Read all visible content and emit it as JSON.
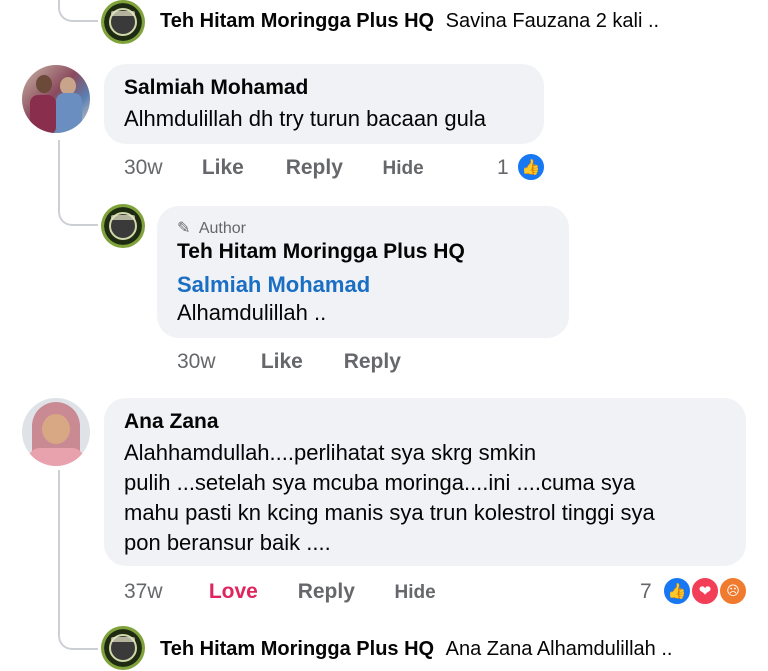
{
  "colors": {
    "thread_line": "#ccd0d5",
    "bubble_bg": "#f0f2f5",
    "meta_gray": "#65676b",
    "mention_blue": "#1a6fc4",
    "love_red": "#e0245e",
    "like_blue": "#1877f2"
  },
  "top_reply": {
    "page_name": "Teh Hitam Moringga Plus HQ",
    "preview": "Savina Fauzana  2 kali .."
  },
  "comment1": {
    "author": "Salmiah Mohamad",
    "text": "Alhmdulillah dh try turun bacaan gula",
    "time": "30w",
    "like_label": "Like",
    "reply_label": "Reply",
    "hide_label": "Hide",
    "reaction_count": "1",
    "reaction_icons": [
      "like-icon"
    ]
  },
  "author_reply": {
    "badge_icon": "pencil-icon",
    "badge_label": "Author",
    "page_name": "Teh Hitam Moringga Plus HQ",
    "mention": "Salmiah Mohamad",
    "text": "Alhamdulillah ..",
    "time": "30w",
    "like_label": "Like",
    "reply_label": "Reply"
  },
  "comment2": {
    "author": "Ana Zana",
    "text_lines": [
      "Alahhamdullah....perlihatat sya skrg smkin",
      "pulih ...setelah sya mcuba moringa....ini ....cuma sya",
      "mahu pasti kn kcing manis sya trun kolestrol tinggi sya",
      "pon beransur baik ...."
    ],
    "time": "37w",
    "love_label": "Love",
    "reply_label": "Reply",
    "hide_label": "Hide",
    "reaction_count": "7",
    "reaction_icons": [
      "like-icon",
      "love-icon",
      "angry-icon"
    ]
  },
  "bottom_reply": {
    "page_name": "Teh Hitam Moringga Plus HQ",
    "preview": "Ana Zana Alhamdulillah .."
  }
}
